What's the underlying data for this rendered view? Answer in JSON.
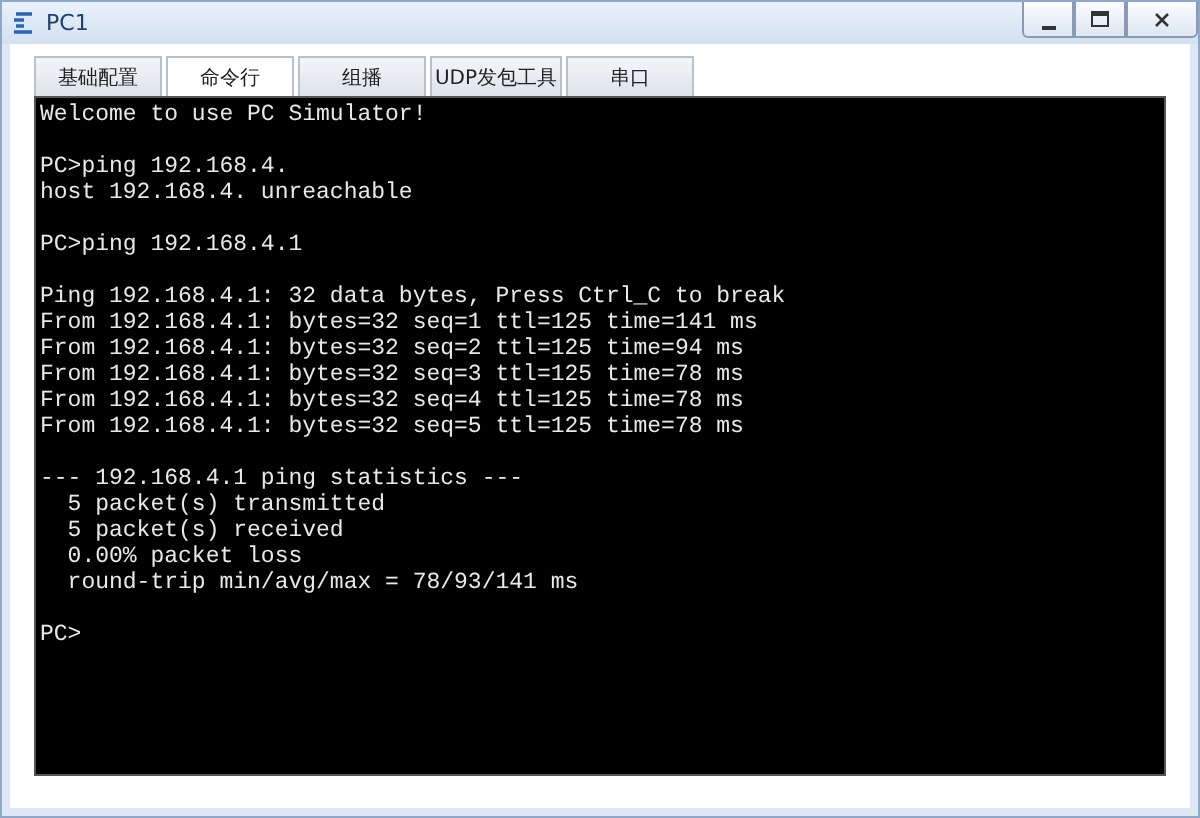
{
  "window": {
    "title": "PC1"
  },
  "tabs": [
    {
      "label": "基础配置",
      "selected": false
    },
    {
      "label": "命令行",
      "selected": true
    },
    {
      "label": "组播",
      "selected": false
    },
    {
      "label": "UDP发包工具",
      "selected": false
    },
    {
      "label": "串口",
      "selected": false
    }
  ],
  "console": {
    "blocks": [
      [
        "Welcome to use PC Simulator!"
      ],
      [
        "PC>ping 192.168.4.",
        "host 192.168.4. unreachable"
      ],
      [
        "PC>ping 192.168.4.1"
      ],
      [
        "Ping 192.168.4.1: 32 data bytes, Press Ctrl_C to break",
        "From 192.168.4.1: bytes=32 seq=1 ttl=125 time=141 ms",
        "From 192.168.4.1: bytes=32 seq=2 ttl=125 time=94 ms",
        "From 192.168.4.1: bytes=32 seq=3 ttl=125 time=78 ms",
        "From 192.168.4.1: bytes=32 seq=4 ttl=125 time=78 ms",
        "From 192.168.4.1: bytes=32 seq=5 ttl=125 time=78 ms"
      ],
      [
        "--- 192.168.4.1 ping statistics ---",
        "  5 packet(s) transmitted",
        "  5 packet(s) received",
        "  0.00% packet loss",
        "  round-trip min/avg/max = 78/93/141 ms"
      ],
      [
        "PC>"
      ]
    ]
  }
}
